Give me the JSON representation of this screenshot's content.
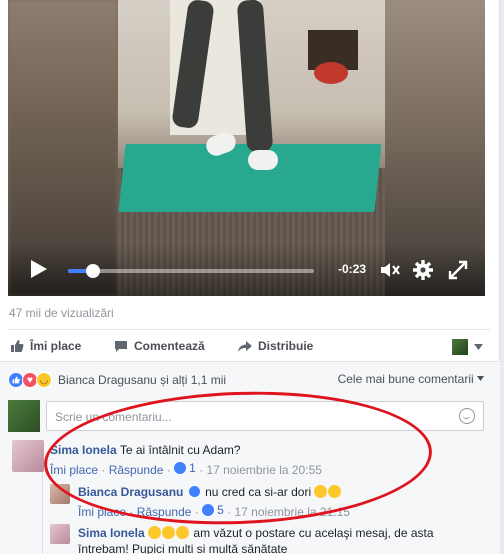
{
  "video": {
    "time_remaining": "-0:23",
    "progress_fraction": 0.1,
    "mute_glyph": "◁✕"
  },
  "views": "47 mii de vizualizări",
  "actions": {
    "like": "Îmi place",
    "comment": "Comentează",
    "share": "Distribuie"
  },
  "reactions": {
    "summary": "Bianca Dragusanu și alți 1,1 mii",
    "sort_label": "Cele mai bune comentarii"
  },
  "composer": {
    "placeholder": "Scrie un comentariu..."
  },
  "comments": [
    {
      "author": "Sima Ionela",
      "text": "Te ai întâlnit cu Adam?",
      "like_label": "Îmi place",
      "reply_label": "Răspunde",
      "like_count": "1",
      "timestamp": "17 noiembrie la 20:55"
    }
  ],
  "replies": [
    {
      "author": "Bianca Dragusanu",
      "text": "nu cred ca si-ar dori",
      "like_label": "Îmi place",
      "reply_label": "Răspunde",
      "like_count": "5",
      "timestamp": "17 noiembrie la 21:15"
    },
    {
      "author": "Sima Ionela",
      "text": "am văzut o postare cu acelaşi mesaj, de asta",
      "text_line2": "întrebam! Pupici multi si multă sănătate"
    }
  ],
  "colors": {
    "facebook_blue": "#4267b2",
    "link_name": "#365899",
    "annotation_red": "#e0141e",
    "mat_teal": "#27a88f"
  }
}
